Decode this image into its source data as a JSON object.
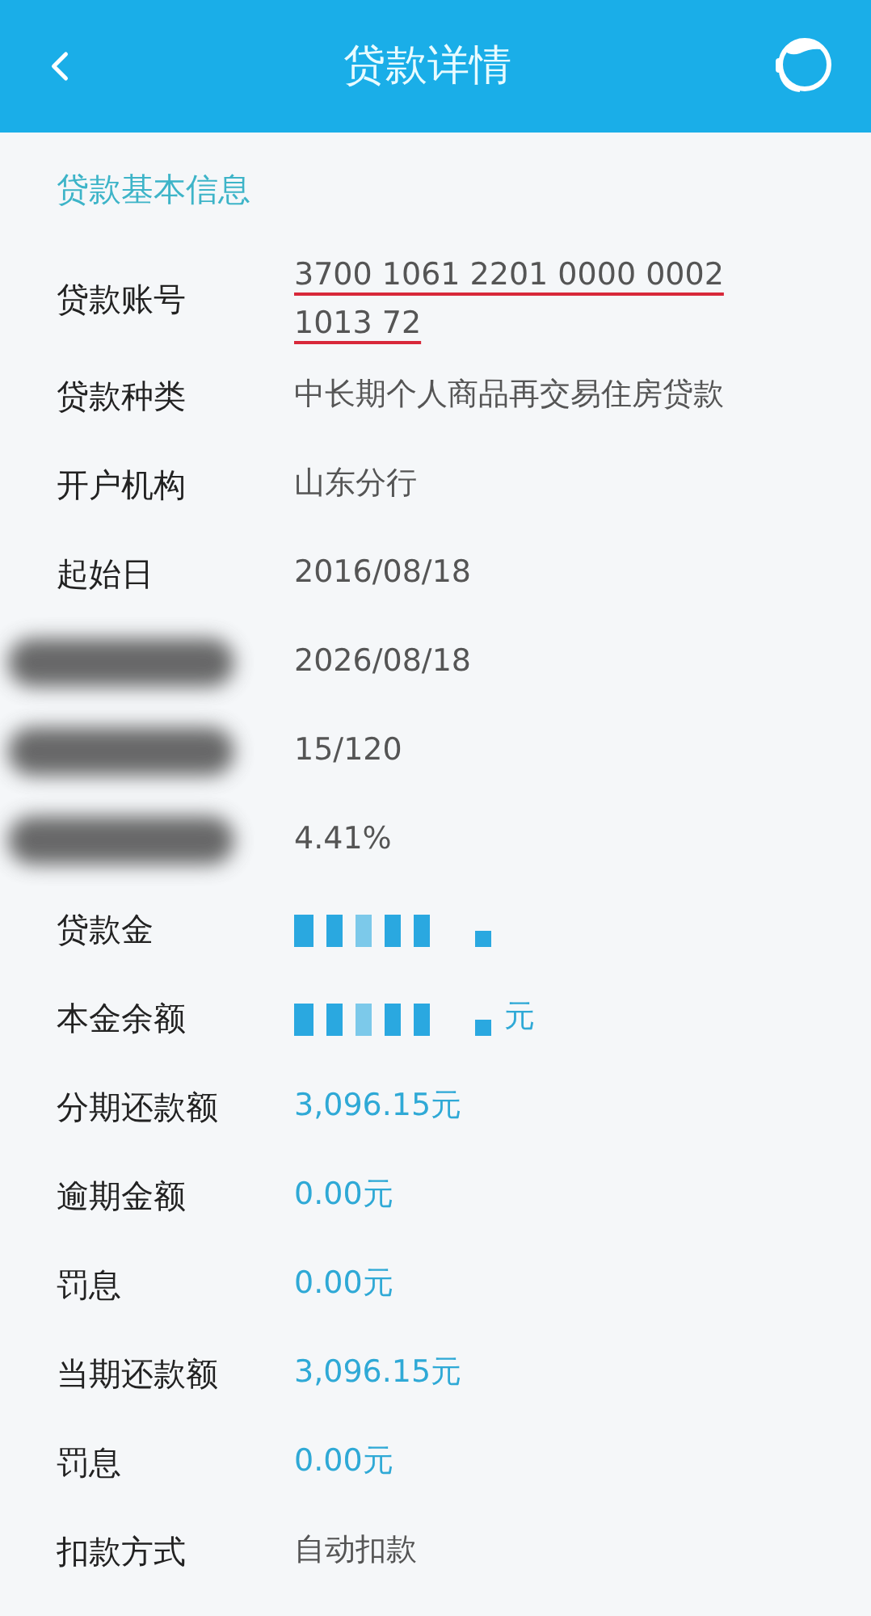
{
  "header": {
    "title": "贷款详情"
  },
  "section": {
    "title": "贷款基本信息"
  },
  "rows": [
    {
      "label": "贷款账号",
      "value": "3700 1061 2201 0000 0002 1013 72",
      "kind": "underlined",
      "label_redacted": false,
      "value_redacted": false
    },
    {
      "label": "贷款种类",
      "value": "中长期个人商品再交易住房贷款",
      "kind": "text",
      "label_redacted": false,
      "value_redacted": false
    },
    {
      "label": "开户机构",
      "value": "山东分行",
      "kind": "text",
      "label_redacted": false,
      "value_redacted": false
    },
    {
      "label": "起始日",
      "value": "2016/08/18",
      "kind": "text",
      "label_redacted": false,
      "value_redacted": false
    },
    {
      "value": "2026/08/18",
      "kind": "text",
      "label_redacted": true,
      "value_redacted": false
    },
    {
      "value": "15/120",
      "kind": "text",
      "label_redacted": true,
      "value_redacted": false
    },
    {
      "value": "4.41%",
      "kind": "text",
      "label_redacted": true,
      "value_redacted": false
    },
    {
      "label": "贷款金",
      "kind": "amount",
      "label_redacted": false,
      "value_redacted": true
    },
    {
      "label": "本金余额",
      "value": "元",
      "kind": "amount",
      "label_redacted": false,
      "value_redacted": true
    },
    {
      "label": "分期还款额",
      "value": "3,096.15元",
      "kind": "amount",
      "label_redacted": false,
      "value_redacted": false
    },
    {
      "label": "逾期金额",
      "value": "0.00元",
      "kind": "amount",
      "label_redacted": false,
      "value_redacted": false
    },
    {
      "label": "罚息",
      "value": "0.00元",
      "kind": "amount",
      "label_redacted": false,
      "value_redacted": false
    },
    {
      "label": "当期还款额",
      "value": "3,096.15元",
      "kind": "amount",
      "label_redacted": false,
      "value_redacted": false
    },
    {
      "label": "罚息",
      "value": "0.00元",
      "kind": "amount",
      "label_redacted": false,
      "value_redacted": false
    },
    {
      "label": "扣款方式",
      "value": "自动扣款",
      "kind": "text",
      "label_redacted": false,
      "value_redacted": false
    }
  ]
}
